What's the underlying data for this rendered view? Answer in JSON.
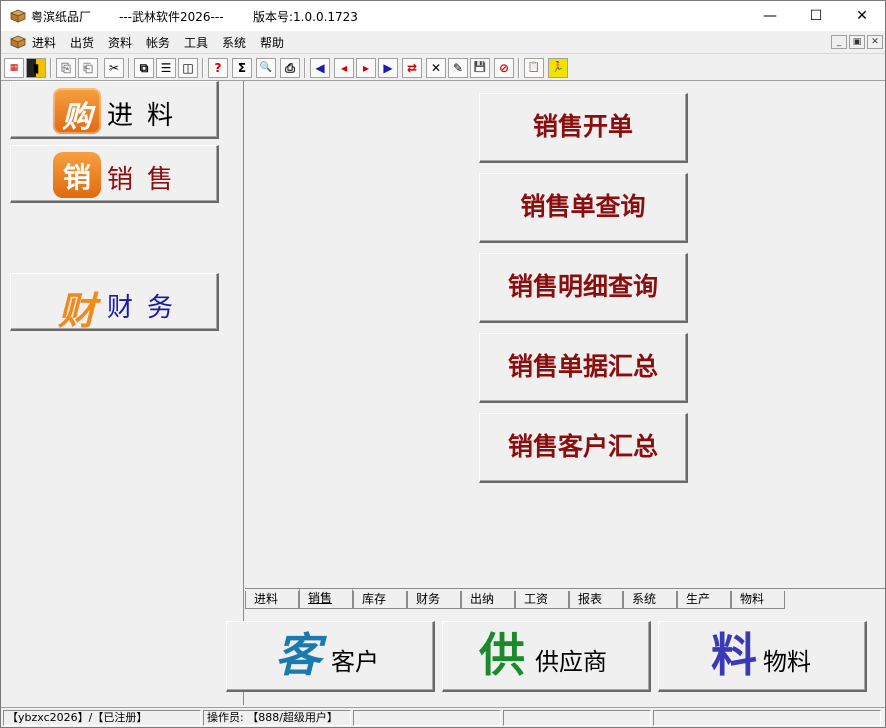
{
  "window": {
    "app_name": "粤滨纸品厂",
    "software": "---武林软件2026---",
    "version": "版本号:1.0.0.1723",
    "min_glyph": "—",
    "max_glyph": "☐",
    "close_glyph": "✕"
  },
  "menu": {
    "items": [
      "进料",
      "出货",
      "资料",
      "帐务",
      "工具",
      "系统",
      "帮助"
    ],
    "mdi_controls": [
      "_",
      "▣",
      "✕"
    ]
  },
  "toolbar": {
    "buttons": [
      "▦",
      "▮",
      "⎘",
      "⎗",
      "✂",
      "⧉",
      "☰",
      "◫",
      "?",
      "Σ",
      "🔍",
      "⎙",
      "◀",
      "◂",
      "▸",
      "▶",
      "⇄",
      "✕",
      "✎",
      "💾",
      "⊘",
      "📋",
      "🏃"
    ]
  },
  "left": {
    "purchase": {
      "icon_char": "购",
      "label": "进料"
    },
    "sales": {
      "icon_char": "销",
      "label": "销售"
    },
    "finance": {
      "icon_char": "财",
      "label": "财务"
    }
  },
  "main": {
    "buttons": [
      "销售开单",
      "销售单查询",
      "销售明细查询",
      "销售单据汇总",
      "销售客户汇总"
    ]
  },
  "tabs": {
    "items": [
      "进料",
      "销售",
      "库存",
      "财务",
      "出纳",
      "工资",
      "报表",
      "系统",
      "生产",
      "物料"
    ],
    "active": "销售"
  },
  "bottom": {
    "customer": {
      "glyph": "客",
      "label": "客户"
    },
    "supplier": {
      "glyph": "供",
      "label": "供应商"
    },
    "material": {
      "glyph": "料",
      "label": "物料"
    }
  },
  "status": {
    "account": "【ybzxc2026】/【已注册】",
    "operator": "操作员: 【888/超级用户】"
  },
  "colors": {
    "sales_text": "#8b0e0e",
    "purchase_text": "#000000",
    "finance_text": "#1a1aa8",
    "customer_glyph": "#1a7ab0",
    "supplier_glyph": "#1a8a2a",
    "material_glyph": "#3a3ab8",
    "icon_orange": "#f08a1c"
  }
}
